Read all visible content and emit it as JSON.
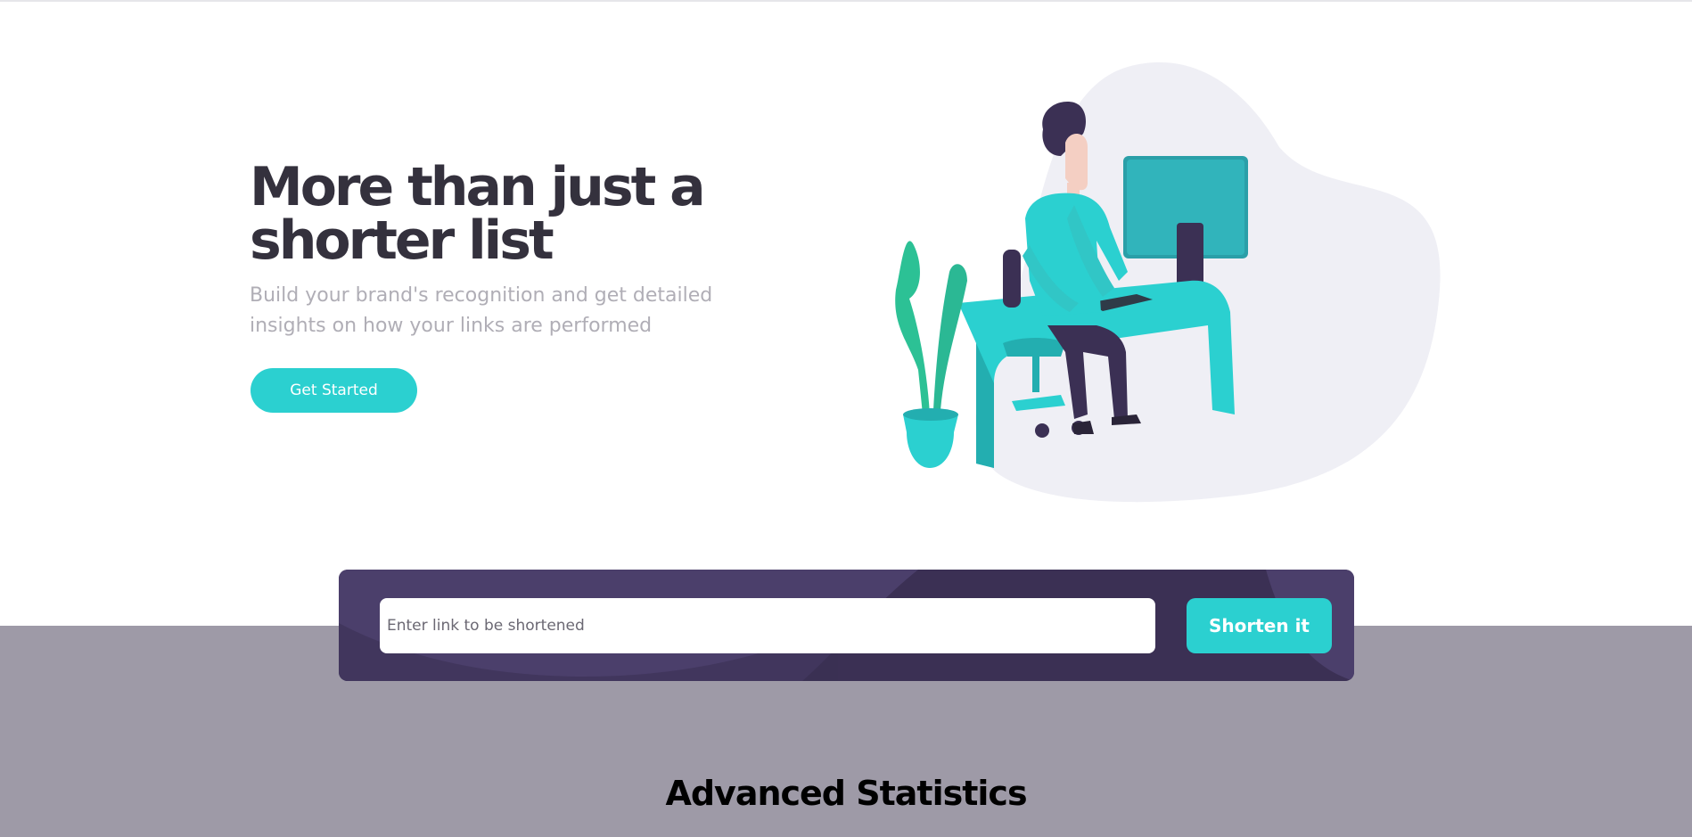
{
  "hero": {
    "title": "More than just a shorter list",
    "subtitle": "Build your brand's recognition and get detailed insights on how your links are performed",
    "cta_label": "Get Started"
  },
  "illustration": {
    "icon": "person-working-at-desk-illustration"
  },
  "shortener": {
    "placeholder": "Enter link to be shortened",
    "value": "",
    "button_label": "Shorten it"
  },
  "statistics": {
    "heading": "Advanced Statistics"
  },
  "colors": {
    "brand_cyan": "#2bd0d0",
    "dark_violet": "#3b3054",
    "heading": "#34313d",
    "muted_text": "#b0aeb6",
    "stats_band": "#9e9aa7"
  }
}
